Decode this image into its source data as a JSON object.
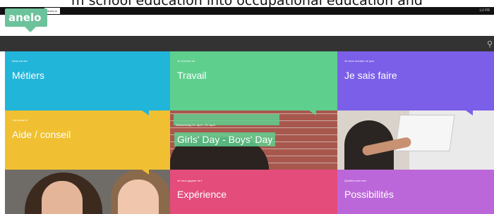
{
  "caption": "m school education into occupational education and",
  "topbar": {
    "tabs": [
      "angebo",
      "anelo.lu",
      "anelo.lu"
    ],
    "lang": "LU FR"
  },
  "logo": "anelo",
  "tiles": {
    "metiers": {
      "small": "Infos sur les",
      "big": "Métiers"
    },
    "travail": {
      "small": "Je cherche du",
      "big": "Travail"
    },
    "sais": {
      "small": "Je veux montrer ce que",
      "big": "Je sais faire"
    },
    "aide": {
      "small": "J'ai besoin d'",
      "big": "Aide / conseil"
    },
    "girls": {
      "date": "Aktiounsdag 23. April - 23. April",
      "title": "Girls' Day - Boys' Day"
    },
    "exp": {
      "small": "Je veux gagner de l'",
      "big": "Expérience"
    },
    "poss": {
      "small": "Quelles sont mes",
      "big": "Possibilités"
    }
  },
  "colors": {
    "metiers": "#22b5da",
    "travail": "#5fcf8e",
    "sais": "#7b5fe8",
    "aide": "#f0c032",
    "exp": "#e44c7c",
    "poss": "#bb67d9",
    "navbar": "#333333"
  },
  "icons": {
    "search": "search-icon"
  }
}
